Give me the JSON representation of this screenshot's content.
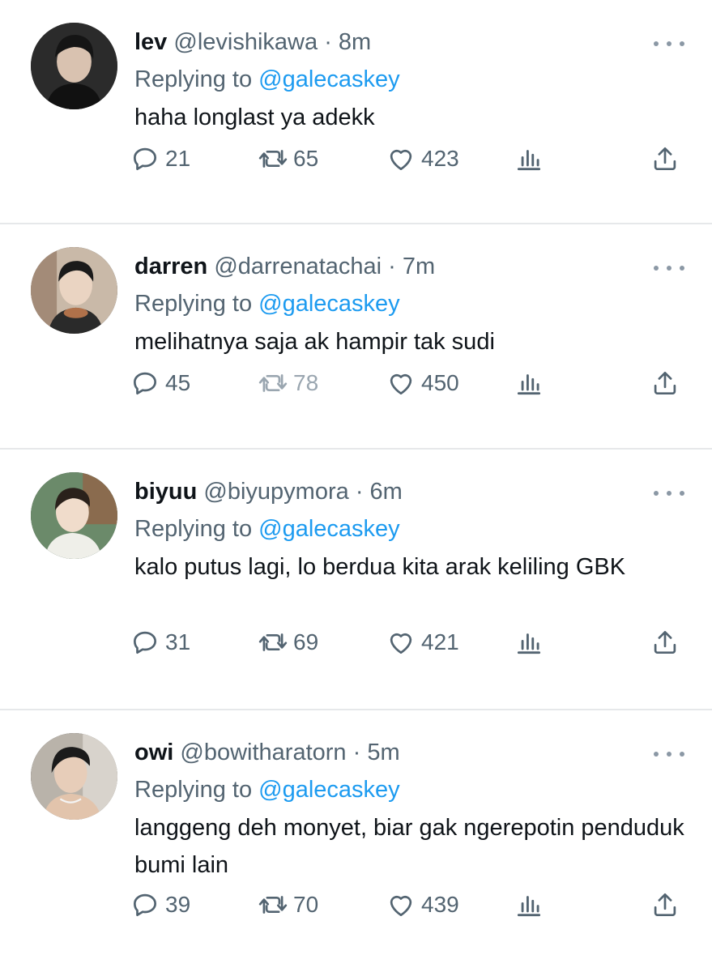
{
  "reply_prefix": "Replying to",
  "tweets": [
    {
      "name": "lev",
      "handle": "@levishikawa",
      "separator": "·",
      "time": "8m",
      "reply_to": "@galecaskey",
      "text": "haha longlast ya adekk",
      "replies": "21",
      "retweets": "65",
      "likes": "423"
    },
    {
      "name": "darren",
      "handle": "@darrenatachai",
      "separator": "·",
      "time": "7m",
      "reply_to": "@galecaskey",
      "text": "melihatnya saja ak hampir tak sudi",
      "replies": "45",
      "retweets": "78",
      "likes": "450"
    },
    {
      "name": "biyuu",
      "handle": "@biyupymora",
      "separator": "·",
      "time": "6m",
      "reply_to": "@galecaskey",
      "text": "kalo putus lagi, lo berdua kita arak keliling GBK",
      "replies": "31",
      "retweets": "69",
      "likes": "421"
    },
    {
      "name": "owi",
      "handle": "@bowitharatorn",
      "separator": "·",
      "time": "5m",
      "reply_to": "@galecaskey",
      "text": "langgeng deh monyet, biar gak ngerepotin penduduk bumi lain",
      "replies": "39",
      "retweets": "70",
      "likes": "439"
    }
  ],
  "colors": {
    "mention": "#1d9bf0",
    "muted": "#536471",
    "text": "#0f1419",
    "divider": "#e6e8ea"
  }
}
